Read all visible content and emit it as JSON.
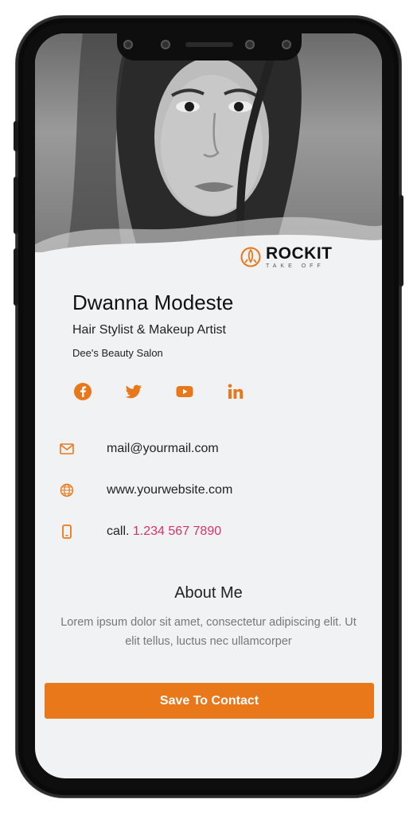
{
  "brand": {
    "name": "ROCKIT",
    "tagline": "TAKE OFF",
    "accent_color": "#e8781a"
  },
  "profile": {
    "name": "Dwanna Modeste",
    "role": "Hair Stylist & Makeup Artist",
    "company": "Dee's Beauty Salon"
  },
  "socials": [
    {
      "icon": "facebook-icon"
    },
    {
      "icon": "twitter-icon"
    },
    {
      "icon": "youtube-icon"
    },
    {
      "icon": "linkedin-icon"
    }
  ],
  "contact": {
    "email": "mail@yourmail.com",
    "website": "www.yourwebsite.com",
    "phone_prefix": "call.",
    "phone_number": "1.234 567 7890",
    "phone_color": "#d6336c"
  },
  "about": {
    "title": "About Me",
    "body": "Lorem ipsum dolor sit amet, consectetur adipiscing elit. Ut elit tellus, luctus nec ullamcorper"
  },
  "actions": {
    "save_label": "Save To Contact"
  }
}
